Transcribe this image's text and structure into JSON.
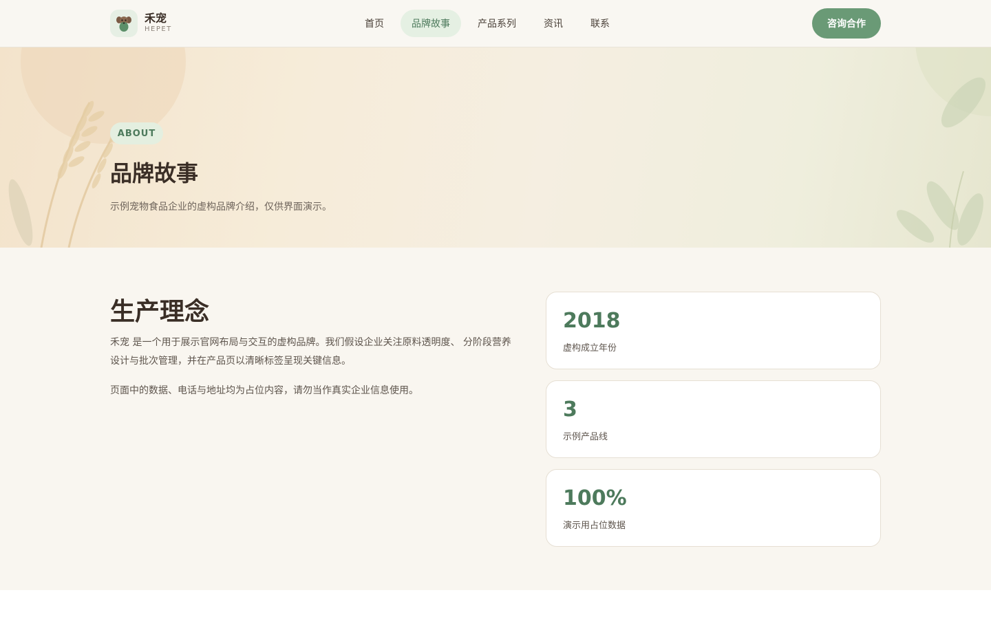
{
  "header": {
    "logo_name": "禾宠",
    "logo_sub": "HEPET",
    "nav": [
      {
        "label": "首页"
      },
      {
        "label": "品牌故事"
      },
      {
        "label": "产品系列"
      },
      {
        "label": "资讯"
      },
      {
        "label": "联系"
      }
    ],
    "active_nav_index": 1,
    "cta_label": "咨询合作"
  },
  "hero": {
    "tag": "ABOUT",
    "title": "品牌故事",
    "subtitle": "示例宠物食品企业的虚构品牌介绍，仅供界面演示。"
  },
  "philosophy": {
    "title": "生产理念",
    "paragraph1": "禾宠 是一个用于展示官网布局与交互的虚构品牌。我们假设企业关注原料透明度、 分阶段营养设计与批次管理，并在产品页以清晰标签呈现关键信息。",
    "paragraph2": "页面中的数据、电话与地址均为占位内容，请勿当作真实企业信息使用。"
  },
  "stats": [
    {
      "value": "2018",
      "label": "虚构成立年份"
    },
    {
      "value": "3",
      "label": "示例产品线"
    },
    {
      "value": "100%",
      "label": "演示用占位数据"
    }
  ],
  "colors": {
    "accent": "#6a9a76",
    "accent_dark": "#4d7a5c",
    "active_nav_bg": "#e5f0e3",
    "text_dark": "#3a2e26",
    "page_bg": "#f9f6f0"
  },
  "icons": {
    "logo": "dog-face-icon"
  }
}
